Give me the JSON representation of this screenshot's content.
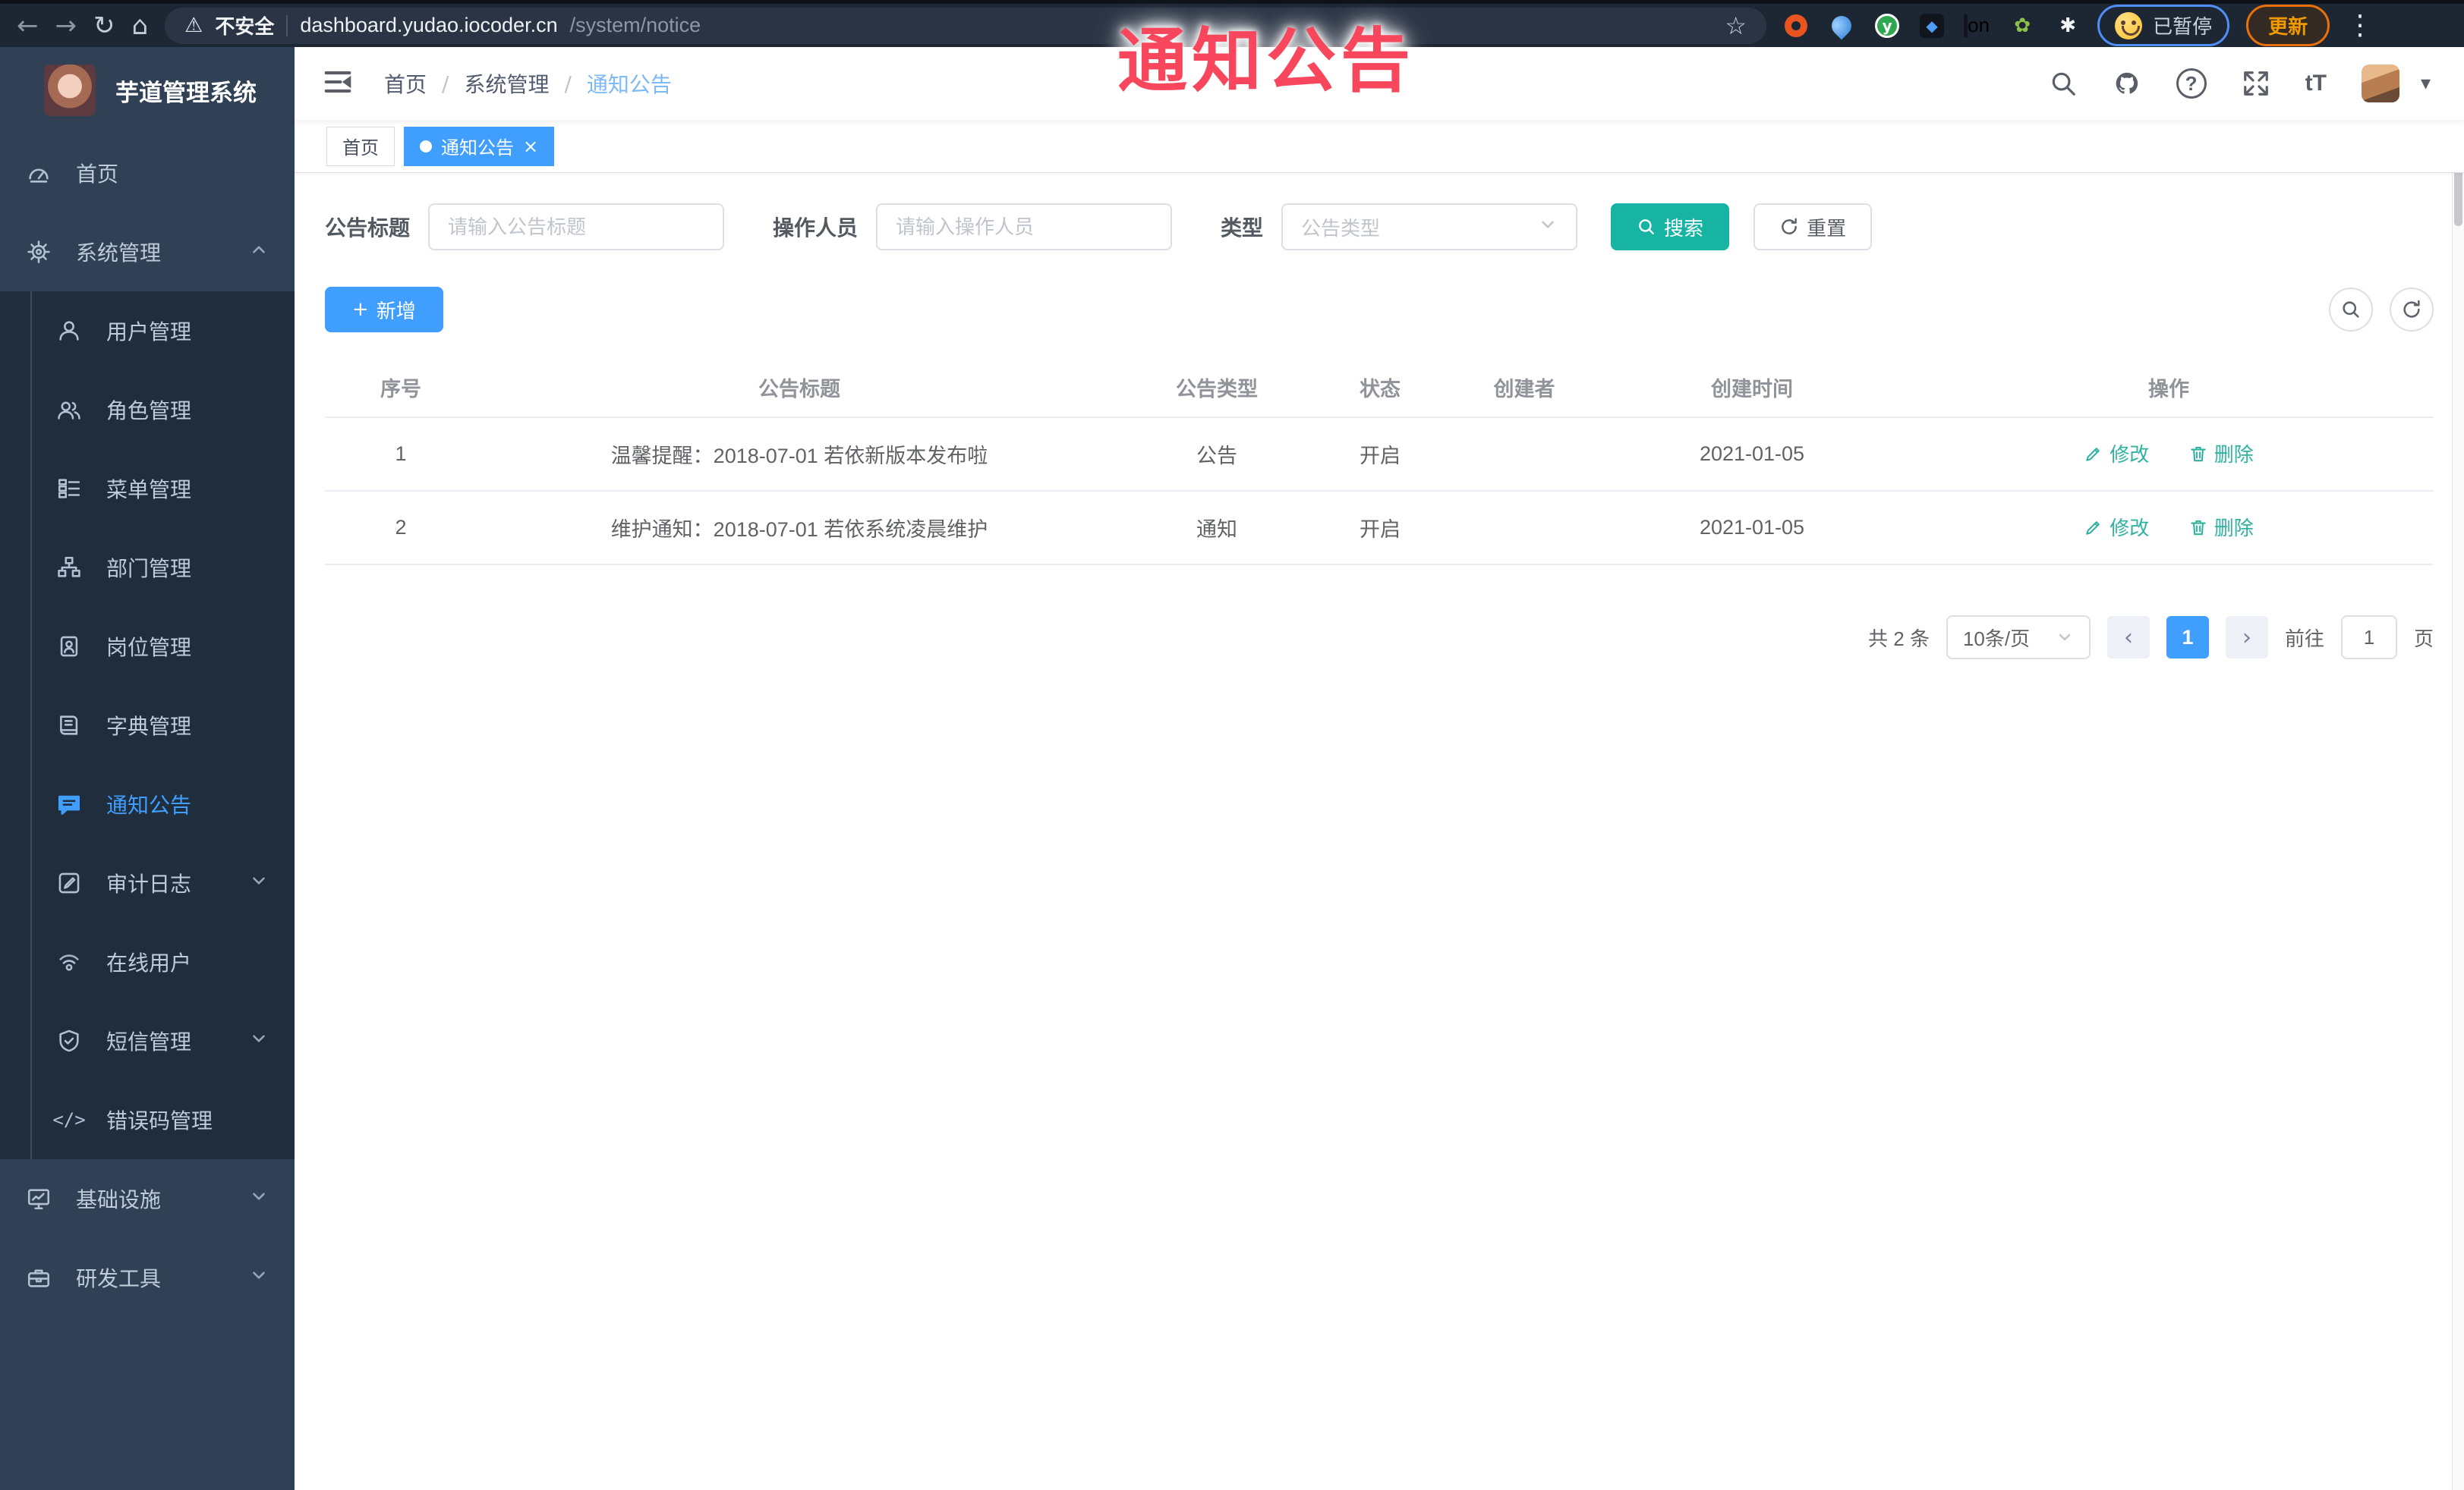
{
  "overlay": {
    "annotation_text": "通知公告"
  },
  "browser": {
    "security_label": "不安全",
    "url_host": "dashboard.yudao.iocoder.cn",
    "url_path": "/system/notice",
    "extension_badge": "on",
    "profile_status": "已暂停",
    "update_button": "更新"
  },
  "icons": {
    "back": "←",
    "forward": "→",
    "reload": "↻",
    "home": "⌂",
    "warning": "⚠",
    "star": "☆",
    "diamond": "◆",
    "leaf": "✿",
    "puzzle": "✱",
    "dots": "⋮",
    "slash": "/",
    "caret_down": "▾",
    "close": "×",
    "plus": "+",
    "font_size": "tT",
    "error_code": "</>",
    "question": "?",
    "prev": "‹",
    "next": "›",
    "y_logo": "y"
  },
  "sidebar": {
    "app_title": "芋道管理系统",
    "items": [
      {
        "label": "首页"
      },
      {
        "label": "系统管理"
      },
      {
        "label": "用户管理"
      },
      {
        "label": "角色管理"
      },
      {
        "label": "菜单管理"
      },
      {
        "label": "部门管理"
      },
      {
        "label": "岗位管理"
      },
      {
        "label": "字典管理"
      },
      {
        "label": "通知公告"
      },
      {
        "label": "审计日志"
      },
      {
        "label": "在线用户"
      },
      {
        "label": "短信管理"
      },
      {
        "label": "错误码管理"
      },
      {
        "label": "基础设施"
      },
      {
        "label": "研发工具"
      }
    ]
  },
  "breadcrumb": {
    "items": [
      "首页",
      "系统管理",
      "通知公告"
    ]
  },
  "tabs": [
    {
      "label": "首页"
    },
    {
      "label": "通知公告"
    }
  ],
  "filters": {
    "title_label": "公告标题",
    "title_placeholder": "请输入公告标题",
    "operator_label": "操作人员",
    "operator_placeholder": "请输入操作人员",
    "type_label": "类型",
    "type_placeholder": "公告类型",
    "search_button": "搜索",
    "reset_button": "重置"
  },
  "toolbar": {
    "add_button": "新增"
  },
  "table": {
    "headers": [
      "序号",
      "公告标题",
      "公告类型",
      "状态",
      "创建者",
      "创建时间",
      "操作"
    ],
    "rows": [
      {
        "index": "1",
        "title": "温馨提醒：2018-07-01 若依新版本发布啦",
        "type": "公告",
        "status": "开启",
        "creator": "",
        "created_at": "2021-01-05"
      },
      {
        "index": "2",
        "title": "维护通知：2018-07-01 若依系统凌晨维护",
        "type": "通知",
        "status": "开启",
        "creator": "",
        "created_at": "2021-01-05"
      }
    ],
    "edit_label": "修改",
    "delete_label": "删除"
  },
  "pagination": {
    "total": "共 2 条",
    "page_size": "10条/页",
    "current_page": "1",
    "goto_label": "前往",
    "goto_value": "1",
    "goto_suffix": "页"
  },
  "colors": {
    "accent": "#409eff",
    "teal_action": "#17b3a3",
    "link_action": "#2fb3a0",
    "annotation_red": "#f8465c",
    "sidebar_dark": "#1f2d3d",
    "sidebar_base": "#304156"
  }
}
